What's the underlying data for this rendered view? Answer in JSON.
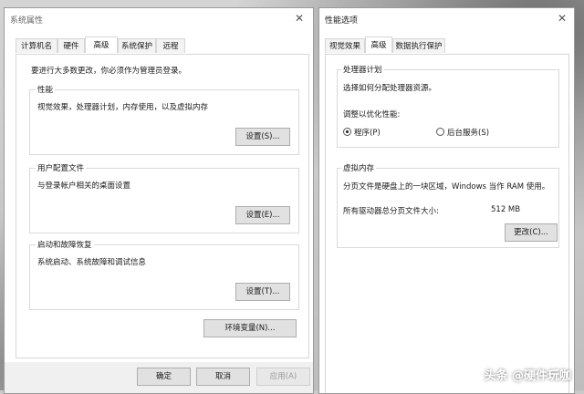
{
  "left_window": {
    "title": "系统属性",
    "tabs": [
      {
        "label": "计算机名"
      },
      {
        "label": "硬件"
      },
      {
        "label": "高级",
        "active": true
      },
      {
        "label": "系统保护"
      },
      {
        "label": "远程"
      }
    ],
    "intro": "要进行大多数更改，你必须作为管理员登录。",
    "performance": {
      "title": "性能",
      "desc": "视觉效果，处理器计划，内存使用，以及虚拟内存",
      "button": "设置(S)..."
    },
    "user_profiles": {
      "title": "用户配置文件",
      "desc": "与登录帐户相关的桌面设置",
      "button": "设置(E)..."
    },
    "startup_recovery": {
      "title": "启动和故障恢复",
      "desc": "系统启动、系统故障和调试信息",
      "button": "设置(T)..."
    },
    "env_button": "环境变量(N)...",
    "ok_button": "确定",
    "cancel_button": "取消",
    "apply_button": "应用(A)"
  },
  "right_window": {
    "title": "性能选项",
    "tabs": [
      {
        "label": "视觉效果"
      },
      {
        "label": "高级",
        "active": true
      },
      {
        "label": "数据执行保护"
      }
    ],
    "processor": {
      "title": "处理器计划",
      "desc": "选择如何分配处理器资源。",
      "adjust_label": "调整以优化性能:",
      "options": [
        {
          "label": "程序(P)",
          "selected": true
        },
        {
          "label": "后台服务(S)",
          "selected": false
        }
      ]
    },
    "virtual_memory": {
      "title": "虚拟内存",
      "desc": "分页文件是硬盘上的一块区域，Windows 当作 RAM 使用。",
      "total_label": "所有驱动器总分页文件大小:",
      "total_value": "512 MB",
      "change_button": "更改(C)..."
    }
  },
  "watermark": "头条 @硬件玩咖"
}
